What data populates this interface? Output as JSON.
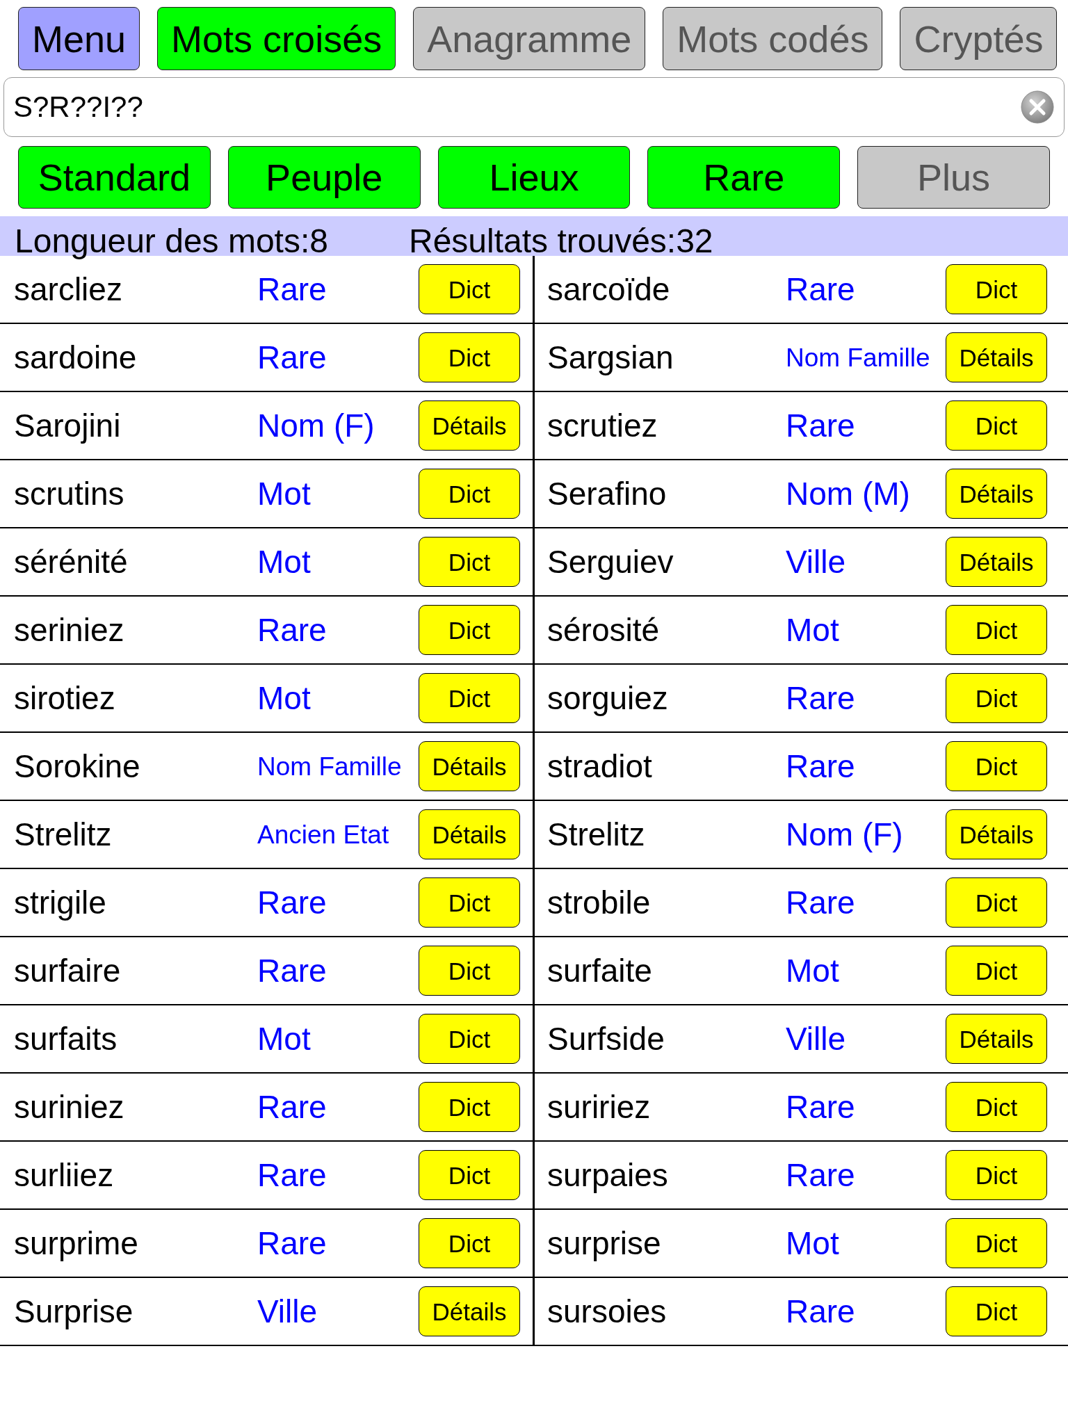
{
  "menu_button": {
    "label": "Menu"
  },
  "tabs": [
    {
      "label": "Mots croisés",
      "selected": true
    },
    {
      "label": "Anagramme",
      "selected": false
    },
    {
      "label": "Mots codés",
      "selected": false
    },
    {
      "label": "Cryptés",
      "selected": false
    }
  ],
  "search": {
    "value": "S?R??I??"
  },
  "filters": [
    {
      "label": "Standard",
      "on": true
    },
    {
      "label": "Peuple",
      "on": true
    },
    {
      "label": "Lieux",
      "on": true
    },
    {
      "label": "Rare",
      "on": true
    },
    {
      "label": "Plus",
      "on": false
    }
  ],
  "info_bar": {
    "word_length": "Longueur des mots:8",
    "results_found": "Résultats trouvés:32"
  },
  "results": [
    [
      {
        "word": "sarcliez",
        "category": "Rare",
        "action": "Dict"
      },
      {
        "word": "sarcoïde",
        "category": "Rare",
        "action": "Dict"
      }
    ],
    [
      {
        "word": "sardoine",
        "category": "Rare",
        "action": "Dict"
      },
      {
        "word": "Sargsian",
        "category": "Nom Famille",
        "action": "Détails"
      }
    ],
    [
      {
        "word": "Sarojini",
        "category": "Nom (F)",
        "action": "Détails"
      },
      {
        "word": "scrutiez",
        "category": "Rare",
        "action": "Dict"
      }
    ],
    [
      {
        "word": "scrutins",
        "category": "Mot",
        "action": "Dict"
      },
      {
        "word": "Serafino",
        "category": "Nom (M)",
        "action": "Détails"
      }
    ],
    [
      {
        "word": "sérénité",
        "category": "Mot",
        "action": "Dict"
      },
      {
        "word": "Serguiev",
        "category": "Ville",
        "action": "Détails"
      }
    ],
    [
      {
        "word": "seriniez",
        "category": "Rare",
        "action": "Dict"
      },
      {
        "word": "sérosité",
        "category": "Mot",
        "action": "Dict"
      }
    ],
    [
      {
        "word": "sirotiez",
        "category": "Mot",
        "action": "Dict"
      },
      {
        "word": "sorguiez",
        "category": "Rare",
        "action": "Dict"
      }
    ],
    [
      {
        "word": "Sorokine",
        "category": "Nom Famille",
        "action": "Détails"
      },
      {
        "word": "stradiot",
        "category": "Rare",
        "action": "Dict"
      }
    ],
    [
      {
        "word": "Strelitz",
        "category": "Ancien Etat",
        "action": "Détails"
      },
      {
        "word": "Strelitz",
        "category": "Nom (F)",
        "action": "Détails"
      }
    ],
    [
      {
        "word": "strigile",
        "category": "Rare",
        "action": "Dict"
      },
      {
        "word": "strobile",
        "category": "Rare",
        "action": "Dict"
      }
    ],
    [
      {
        "word": "surfaire",
        "category": "Rare",
        "action": "Dict"
      },
      {
        "word": "surfaite",
        "category": "Mot",
        "action": "Dict"
      }
    ],
    [
      {
        "word": "surfaits",
        "category": "Mot",
        "action": "Dict"
      },
      {
        "word": "Surfside",
        "category": "Ville",
        "action": "Détails"
      }
    ],
    [
      {
        "word": "suriniez",
        "category": "Rare",
        "action": "Dict"
      },
      {
        "word": "suririez",
        "category": "Rare",
        "action": "Dict"
      }
    ],
    [
      {
        "word": "surliiez",
        "category": "Rare",
        "action": "Dict"
      },
      {
        "word": "surpaies",
        "category": "Rare",
        "action": "Dict"
      }
    ],
    [
      {
        "word": "surprime",
        "category": "Rare",
        "action": "Dict"
      },
      {
        "word": "surprise",
        "category": "Mot",
        "action": "Dict"
      }
    ],
    [
      {
        "word": "Surprise",
        "category": "Ville",
        "action": "Détails"
      },
      {
        "word": "sursoies",
        "category": "Rare",
        "action": "Dict"
      }
    ]
  ]
}
